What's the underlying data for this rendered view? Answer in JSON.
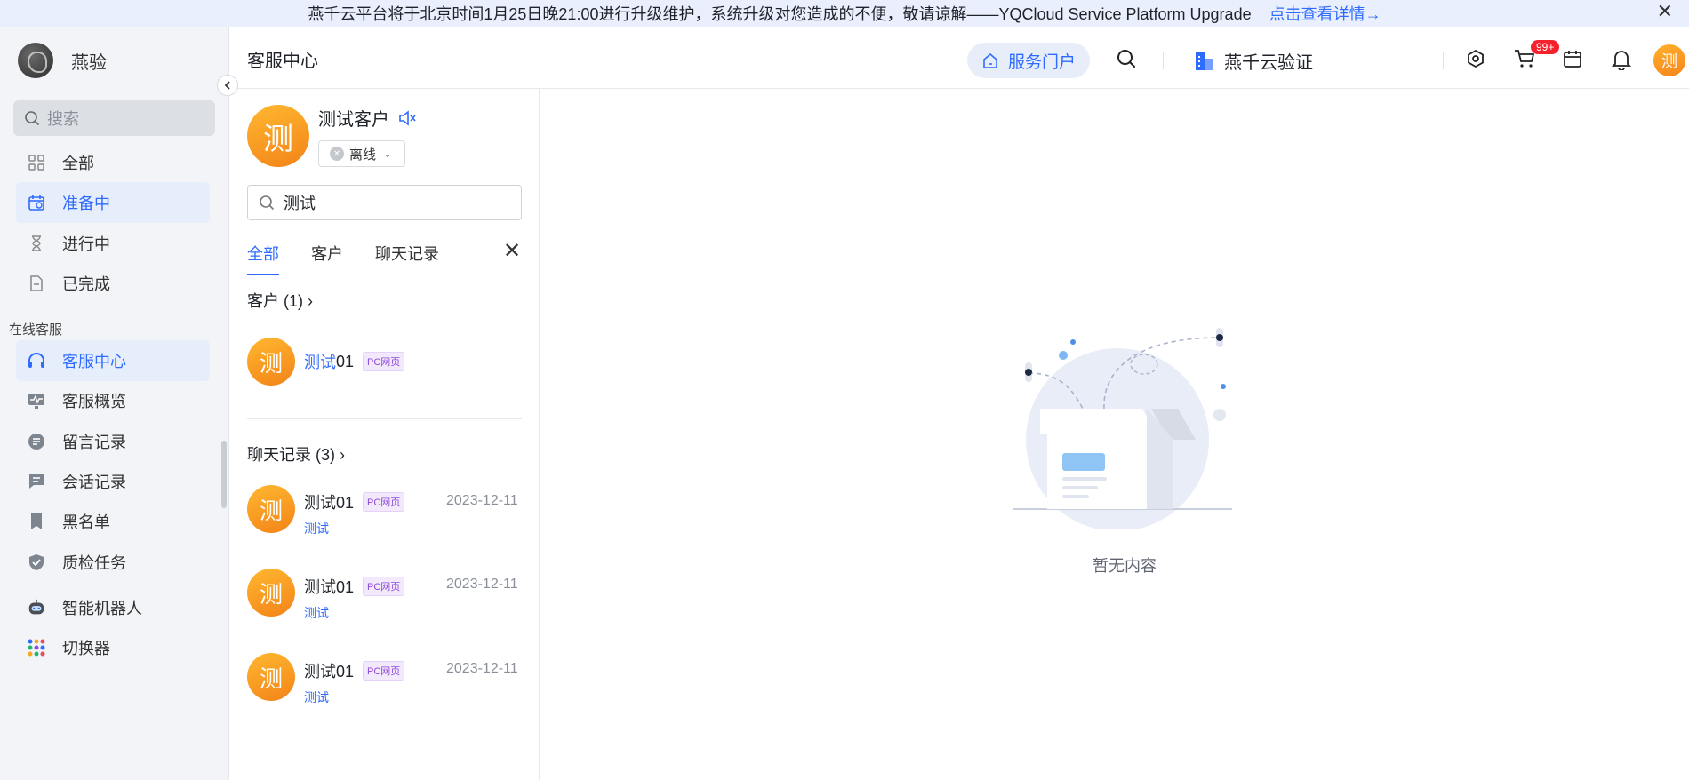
{
  "banner": {
    "message": "燕千云平台将于北京时间1月25日晚21:00进行升级维护，系统升级对您造成的不便，敬请谅解——YQCloud Service Platform Upgrade",
    "link": "点击查看详情→",
    "close": "✕"
  },
  "sidebar": {
    "brand_name": "燕验",
    "search_placeholder": "搜索",
    "items_top": [
      {
        "label": "全部",
        "icon": "grid-icon"
      },
      {
        "label": "准备中",
        "icon": "calendar-check-icon"
      },
      {
        "label": "进行中",
        "icon": "hourglass-icon"
      },
      {
        "label": "已完成",
        "icon": "document-icon"
      }
    ],
    "section_label": "在线客服",
    "items_online": [
      {
        "label": "客服中心",
        "icon": "headset-icon"
      },
      {
        "label": "客服概览",
        "icon": "monitor-pulse-icon"
      },
      {
        "label": "留言记录",
        "icon": "message-list-icon"
      },
      {
        "label": "会话记录",
        "icon": "chat-icon"
      },
      {
        "label": "黑名单",
        "icon": "bookmark-icon"
      },
      {
        "label": "质检任务",
        "icon": "shield-check-icon"
      },
      {
        "label": "智能机器人",
        "icon": "robot-icon"
      },
      {
        "label": "切换器",
        "icon": "apps-grid-icon"
      }
    ]
  },
  "header": {
    "title": "客服中心",
    "portal_label": "服务门户",
    "org_name": "燕千云验证",
    "notification_badge": "99+",
    "avatar_char": "测"
  },
  "profile": {
    "avatar_char": "测",
    "name": "测试客户",
    "status": "离线"
  },
  "search": {
    "value": "测试"
  },
  "tabs": [
    "全部",
    "客户",
    "聊天记录"
  ],
  "groups": {
    "customers_title": "客户 (1)",
    "chats_title": "聊天记录 (3)"
  },
  "customers": [
    {
      "avatar": "测",
      "name_highlight": "测试",
      "name_rest": "01",
      "tag": "PC网页"
    }
  ],
  "chats": [
    {
      "avatar": "测",
      "name": "测试01",
      "tag": "PC网页",
      "date": "2023-12-11",
      "message": "测试"
    },
    {
      "avatar": "测",
      "name": "测试01",
      "tag": "PC网页",
      "date": "2023-12-11",
      "message": "测试"
    },
    {
      "avatar": "测",
      "name": "测试01",
      "tag": "PC网页",
      "date": "2023-12-11",
      "message": "测试"
    }
  ],
  "empty_state": {
    "text": "暂无内容"
  },
  "colors": {
    "accent": "#2f6bff",
    "avatar_orange": "#f7831c",
    "badge_red": "#f5222d",
    "tag_purple": "#8e4ad8"
  }
}
